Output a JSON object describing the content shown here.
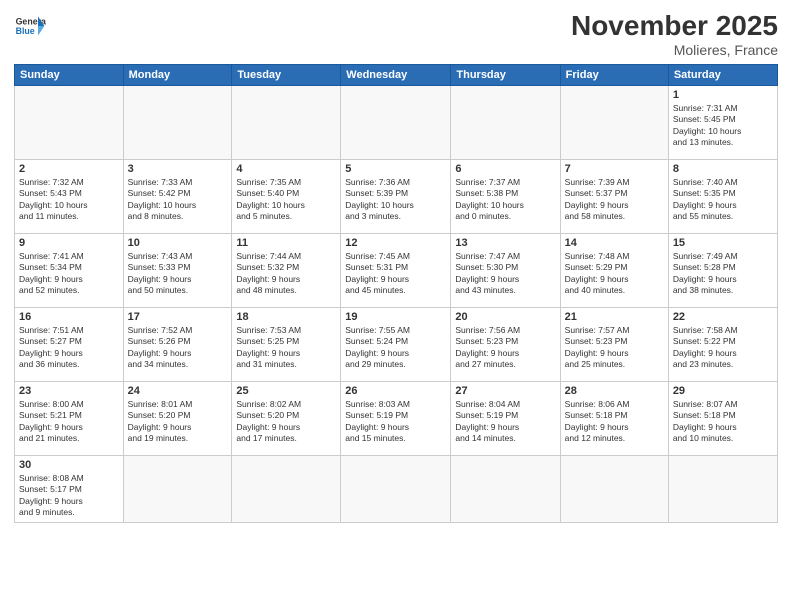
{
  "header": {
    "logo_general": "General",
    "logo_blue": "Blue",
    "month_title": "November 2025",
    "location": "Molieres, France"
  },
  "weekdays": [
    "Sunday",
    "Monday",
    "Tuesday",
    "Wednesday",
    "Thursday",
    "Friday",
    "Saturday"
  ],
  "weeks": [
    [
      {
        "day": "",
        "info": ""
      },
      {
        "day": "",
        "info": ""
      },
      {
        "day": "",
        "info": ""
      },
      {
        "day": "",
        "info": ""
      },
      {
        "day": "",
        "info": ""
      },
      {
        "day": "",
        "info": ""
      },
      {
        "day": "1",
        "info": "Sunrise: 7:31 AM\nSunset: 5:45 PM\nDaylight: 10 hours\nand 13 minutes."
      }
    ],
    [
      {
        "day": "2",
        "info": "Sunrise: 7:32 AM\nSunset: 5:43 PM\nDaylight: 10 hours\nand 11 minutes."
      },
      {
        "day": "3",
        "info": "Sunrise: 7:33 AM\nSunset: 5:42 PM\nDaylight: 10 hours\nand 8 minutes."
      },
      {
        "day": "4",
        "info": "Sunrise: 7:35 AM\nSunset: 5:40 PM\nDaylight: 10 hours\nand 5 minutes."
      },
      {
        "day": "5",
        "info": "Sunrise: 7:36 AM\nSunset: 5:39 PM\nDaylight: 10 hours\nand 3 minutes."
      },
      {
        "day": "6",
        "info": "Sunrise: 7:37 AM\nSunset: 5:38 PM\nDaylight: 10 hours\nand 0 minutes."
      },
      {
        "day": "7",
        "info": "Sunrise: 7:39 AM\nSunset: 5:37 PM\nDaylight: 9 hours\nand 58 minutes."
      },
      {
        "day": "8",
        "info": "Sunrise: 7:40 AM\nSunset: 5:35 PM\nDaylight: 9 hours\nand 55 minutes."
      }
    ],
    [
      {
        "day": "9",
        "info": "Sunrise: 7:41 AM\nSunset: 5:34 PM\nDaylight: 9 hours\nand 52 minutes."
      },
      {
        "day": "10",
        "info": "Sunrise: 7:43 AM\nSunset: 5:33 PM\nDaylight: 9 hours\nand 50 minutes."
      },
      {
        "day": "11",
        "info": "Sunrise: 7:44 AM\nSunset: 5:32 PM\nDaylight: 9 hours\nand 48 minutes."
      },
      {
        "day": "12",
        "info": "Sunrise: 7:45 AM\nSunset: 5:31 PM\nDaylight: 9 hours\nand 45 minutes."
      },
      {
        "day": "13",
        "info": "Sunrise: 7:47 AM\nSunset: 5:30 PM\nDaylight: 9 hours\nand 43 minutes."
      },
      {
        "day": "14",
        "info": "Sunrise: 7:48 AM\nSunset: 5:29 PM\nDaylight: 9 hours\nand 40 minutes."
      },
      {
        "day": "15",
        "info": "Sunrise: 7:49 AM\nSunset: 5:28 PM\nDaylight: 9 hours\nand 38 minutes."
      }
    ],
    [
      {
        "day": "16",
        "info": "Sunrise: 7:51 AM\nSunset: 5:27 PM\nDaylight: 9 hours\nand 36 minutes."
      },
      {
        "day": "17",
        "info": "Sunrise: 7:52 AM\nSunset: 5:26 PM\nDaylight: 9 hours\nand 34 minutes."
      },
      {
        "day": "18",
        "info": "Sunrise: 7:53 AM\nSunset: 5:25 PM\nDaylight: 9 hours\nand 31 minutes."
      },
      {
        "day": "19",
        "info": "Sunrise: 7:55 AM\nSunset: 5:24 PM\nDaylight: 9 hours\nand 29 minutes."
      },
      {
        "day": "20",
        "info": "Sunrise: 7:56 AM\nSunset: 5:23 PM\nDaylight: 9 hours\nand 27 minutes."
      },
      {
        "day": "21",
        "info": "Sunrise: 7:57 AM\nSunset: 5:23 PM\nDaylight: 9 hours\nand 25 minutes."
      },
      {
        "day": "22",
        "info": "Sunrise: 7:58 AM\nSunset: 5:22 PM\nDaylight: 9 hours\nand 23 minutes."
      }
    ],
    [
      {
        "day": "23",
        "info": "Sunrise: 8:00 AM\nSunset: 5:21 PM\nDaylight: 9 hours\nand 21 minutes."
      },
      {
        "day": "24",
        "info": "Sunrise: 8:01 AM\nSunset: 5:20 PM\nDaylight: 9 hours\nand 19 minutes."
      },
      {
        "day": "25",
        "info": "Sunrise: 8:02 AM\nSunset: 5:20 PM\nDaylight: 9 hours\nand 17 minutes."
      },
      {
        "day": "26",
        "info": "Sunrise: 8:03 AM\nSunset: 5:19 PM\nDaylight: 9 hours\nand 15 minutes."
      },
      {
        "day": "27",
        "info": "Sunrise: 8:04 AM\nSunset: 5:19 PM\nDaylight: 9 hours\nand 14 minutes."
      },
      {
        "day": "28",
        "info": "Sunrise: 8:06 AM\nSunset: 5:18 PM\nDaylight: 9 hours\nand 12 minutes."
      },
      {
        "day": "29",
        "info": "Sunrise: 8:07 AM\nSunset: 5:18 PM\nDaylight: 9 hours\nand 10 minutes."
      }
    ],
    [
      {
        "day": "30",
        "info": "Sunrise: 8:08 AM\nSunset: 5:17 PM\nDaylight: 9 hours\nand 9 minutes."
      },
      {
        "day": "",
        "info": ""
      },
      {
        "day": "",
        "info": ""
      },
      {
        "day": "",
        "info": ""
      },
      {
        "day": "",
        "info": ""
      },
      {
        "day": "",
        "info": ""
      },
      {
        "day": "",
        "info": ""
      }
    ]
  ]
}
